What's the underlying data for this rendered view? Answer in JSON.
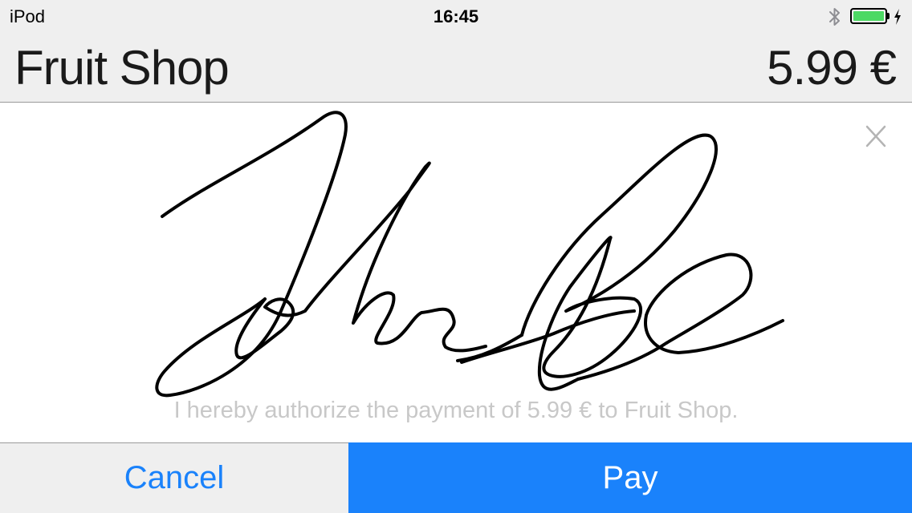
{
  "status_bar": {
    "device": "iPod",
    "time": "16:45",
    "battery_level": 1.0,
    "icons": [
      "bluetooth-icon",
      "battery-icon",
      "charging-icon"
    ],
    "battery_color": "#4cd964"
  },
  "header": {
    "title": "Fruit Shop",
    "amount": "5.99 €"
  },
  "signature": {
    "clear_label": "X",
    "authorization_text": "I hereby authorize the payment of 5.99 € to Fruit Shop."
  },
  "actions": {
    "cancel_label": "Cancel",
    "pay_label": "Pay"
  },
  "colors": {
    "accent": "#1a82fb",
    "bar_background": "#efefef",
    "auth_text": "#c8c8c8"
  }
}
